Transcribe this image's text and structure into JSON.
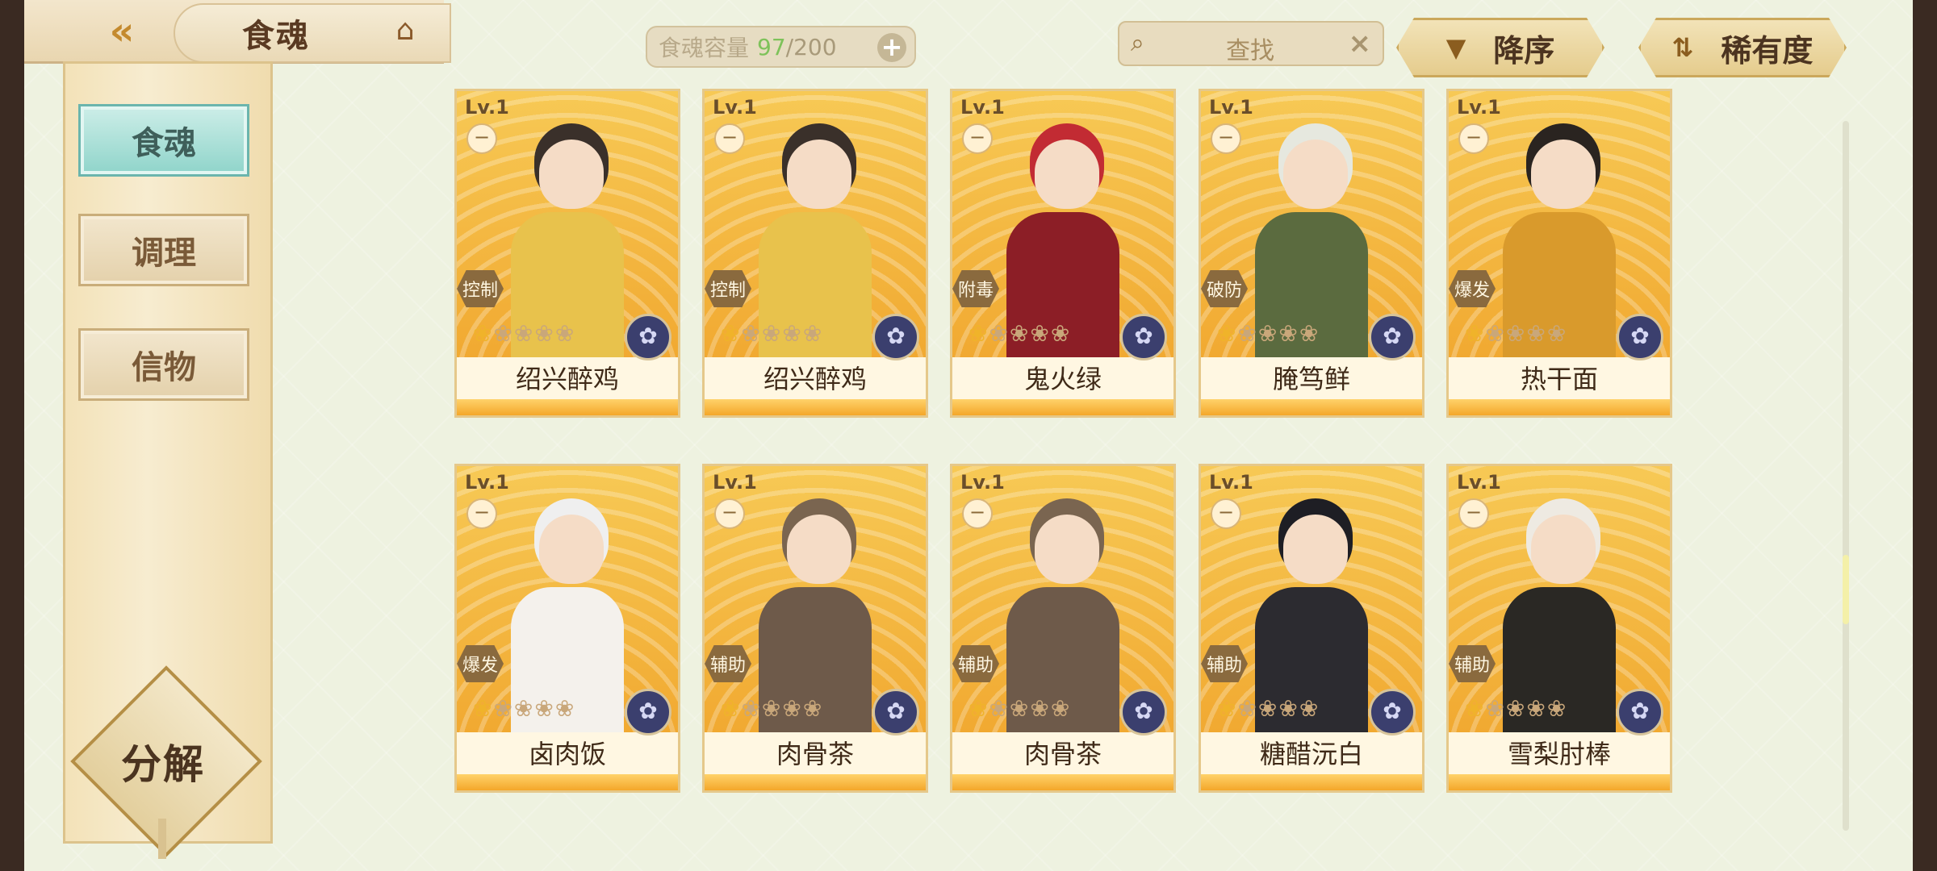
{
  "header": {
    "back_icon": "back-chevron-icon",
    "title": "食魂",
    "home_icon": "pavilion-icon",
    "capacity_label": "食魂容量",
    "capacity_current": "97",
    "capacity_max": "/200",
    "capacity_add": "+",
    "search_placeholder": "查找",
    "search_clear": "×",
    "sort_order_label": "降序",
    "sort_field_label": "稀有度"
  },
  "sidebar": {
    "items": [
      {
        "label": "食魂",
        "active": true
      },
      {
        "label": "调理",
        "active": false
      },
      {
        "label": "信物",
        "active": false
      }
    ],
    "decompose_label": "分解"
  },
  "colors": {
    "accent_teal": "#8fd4ca",
    "card_gold": "#f1a931",
    "capacity_green": "#7ec25a"
  },
  "cards": [
    {
      "level": "Lv.1",
      "role": "控制",
      "name": "绍兴醉鸡",
      "hair": "#3a302a",
      "cloth": "#e8c24c"
    },
    {
      "level": "Lv.1",
      "role": "控制",
      "name": "绍兴醉鸡",
      "hair": "#3a302a",
      "cloth": "#e8c24c"
    },
    {
      "level": "Lv.1",
      "role": "附毒",
      "name": "鬼火绿",
      "hair": "#c22b33",
      "cloth": "#8c1e26"
    },
    {
      "level": "Lv.1",
      "role": "破防",
      "name": "腌笃鲜",
      "hair": "#e6e8df",
      "cloth": "#5b6b3f"
    },
    {
      "level": "Lv.1",
      "role": "爆发",
      "name": "热干面",
      "hair": "#2a2420",
      "cloth": "#d99a2c"
    },
    {
      "level": "Lv.1",
      "role": "爆发",
      "name": "卤肉饭",
      "hair": "#efefef",
      "cloth": "#f4f1ec"
    },
    {
      "level": "Lv.1",
      "role": "辅助",
      "name": "肉骨茶",
      "hair": "#7a6550",
      "cloth": "#6e5a4a"
    },
    {
      "level": "Lv.1",
      "role": "辅助",
      "name": "肉骨茶",
      "hair": "#7a6550",
      "cloth": "#6e5a4a"
    },
    {
      "level": "Lv.1",
      "role": "辅助",
      "name": "糖醋沅白",
      "hair": "#1e1e24",
      "cloth": "#2c2b30"
    },
    {
      "level": "Lv.1",
      "role": "辅助",
      "name": "雪梨肘棒",
      "hair": "#eeeae2",
      "cloth": "#2a2824"
    }
  ],
  "card_common": {
    "minus_symbol": "−",
    "stars": "ᕦᕦᕦᕦᕦ",
    "element_icon": "flower-element-icon"
  }
}
